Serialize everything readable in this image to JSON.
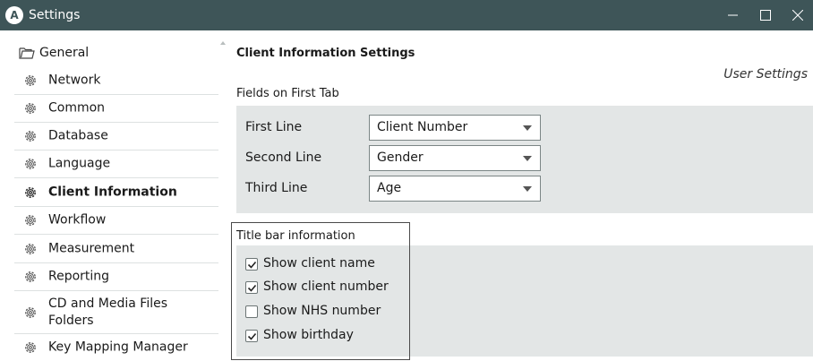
{
  "window": {
    "app_logo_letter": "A",
    "title": "Settings",
    "controls": {
      "minimize": "minimize-icon",
      "maximize": "maximize-icon",
      "close": "close-icon"
    }
  },
  "sidebar": {
    "root": {
      "label": "General",
      "icon": "folder-icon"
    },
    "items": [
      {
        "label": "Network",
        "icon": "gear-icon",
        "active": false
      },
      {
        "label": "Common",
        "icon": "gear-icon",
        "active": false
      },
      {
        "label": "Database",
        "icon": "gear-icon",
        "active": false
      },
      {
        "label": "Language",
        "icon": "gear-icon",
        "active": false
      },
      {
        "label": "Client Information",
        "icon": "gear-icon",
        "active": true
      },
      {
        "label": "Workflow",
        "icon": "gear-icon",
        "active": false
      },
      {
        "label": "Measurement",
        "icon": "gear-icon",
        "active": false
      },
      {
        "label": "Reporting",
        "icon": "gear-icon",
        "active": false
      },
      {
        "label": "CD and Media Files\nFolders",
        "icon": "gear-icon",
        "active": false
      },
      {
        "label": "Key Mapping Manager",
        "icon": "gear-icon",
        "active": false
      }
    ]
  },
  "main": {
    "title": "Client Information Settings",
    "scope_label": "User Settings",
    "fields_section": {
      "label": "Fields on First Tab",
      "rows": [
        {
          "label": "First Line",
          "value": "Client Number"
        },
        {
          "label": "Second Line",
          "value": "Gender"
        },
        {
          "label": "Third Line",
          "value": "Age"
        }
      ]
    },
    "titlebar_section": {
      "label": "Title bar information",
      "options": [
        {
          "label": "Show client name",
          "checked": true
        },
        {
          "label": "Show client number",
          "checked": true
        },
        {
          "label": "Show NHS number",
          "checked": false
        },
        {
          "label": "Show birthday",
          "checked": true
        }
      ]
    }
  },
  "colors": {
    "titlebar_bg": "#3e5558",
    "panel_bg": "#e3e6e6",
    "window_bg": "#ffffff"
  }
}
